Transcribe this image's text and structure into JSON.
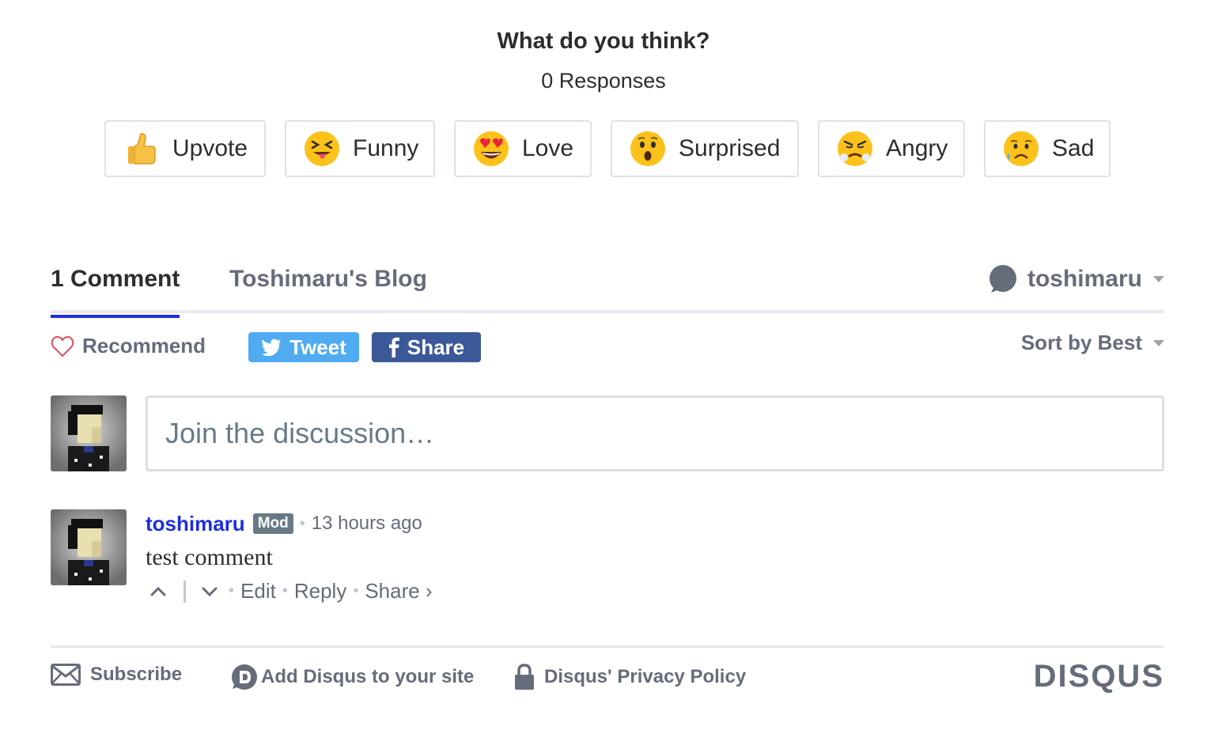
{
  "reactions": {
    "title": "What do you think?",
    "count": "0 Responses",
    "items": [
      {
        "label": "Upvote",
        "icon": "thumbs-up-emoji"
      },
      {
        "label": "Funny",
        "icon": "squinting-tongue-emoji"
      },
      {
        "label": "Love",
        "icon": "heart-eyes-emoji"
      },
      {
        "label": "Surprised",
        "icon": "surprised-emoji"
      },
      {
        "label": "Angry",
        "icon": "angry-steam-emoji"
      },
      {
        "label": "Sad",
        "icon": "sad-sweat-emoji"
      }
    ]
  },
  "nav": {
    "comments_tab": "1 Comment",
    "forum_tab": "Toshimaru's Blog",
    "user_name": "toshimaru"
  },
  "toolbar": {
    "recommend": "Recommend",
    "tweet": "Tweet",
    "share": "Share",
    "sort": "Sort by Best"
  },
  "composer": {
    "placeholder": "Join the discussion…"
  },
  "comment": {
    "author": "toshimaru",
    "badge": "Mod",
    "time": "13 hours ago",
    "body": "test comment",
    "actions": {
      "edit": "Edit",
      "reply": "Reply",
      "share": "Share ›"
    }
  },
  "footer": {
    "subscribe": "Subscribe",
    "add_disqus": "Add Disqus to your site",
    "privacy": "Disqus' Privacy Policy",
    "logo": "DISQUS"
  },
  "colors": {
    "accent": "#1d2fdc",
    "twitter": "#50abf1",
    "facebook": "#3b5998",
    "muted": "#656c7a"
  }
}
